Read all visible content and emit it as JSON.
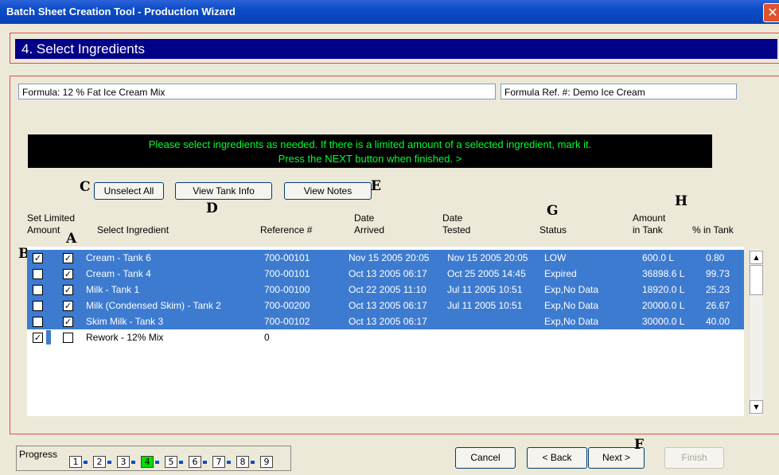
{
  "window": {
    "title": "Batch Sheet Creation Tool - Production Wizard",
    "close_glyph": "✕"
  },
  "step": {
    "title": "4. Select Ingredients"
  },
  "formula": {
    "name": "Formula: 12 % Fat Ice Cream Mix",
    "ref": "Formula Ref. #:  Demo Ice Cream"
  },
  "message": {
    "line1": "Please select ingredients as needed. If there is a limited amount of a selected ingredient, mark it.",
    "line2": "Press the NEXT button when finished. >"
  },
  "buttons": {
    "unselect_all": "Unselect All",
    "view_tank_info": "View Tank Info",
    "view_notes": "View Notes",
    "cancel": "Cancel",
    "back": "< Back",
    "next": "Next >",
    "finish": "Finish"
  },
  "annotations": {
    "A": "A",
    "B": "B",
    "C": "C",
    "D": "D",
    "E": "E",
    "F": "F",
    "G": "G",
    "H": "H"
  },
  "columns": {
    "set_limited_1": "Set Limited",
    "set_limited_2": "Amount",
    "select_ingredient": "Select Ingredient",
    "reference": "Reference #",
    "date_arrived_1": "Date",
    "date_arrived_2": "Arrived",
    "date_tested_1": "Date",
    "date_tested_2": "Tested",
    "status": "Status",
    "amount_1": "Amount",
    "amount_2": "in Tank",
    "pct": "% in Tank"
  },
  "rows": [
    {
      "limited": true,
      "selected": true,
      "name": "Cream - Tank 6",
      "ref": "700-00101",
      "arrived": "Nov 15 2005 20:05",
      "tested": "Nov 15 2005 20:05",
      "status": "LOW",
      "amount": "600.0 L",
      "pct": "0.80",
      "highlight": true
    },
    {
      "limited": false,
      "selected": true,
      "name": "Cream - Tank 4",
      "ref": "700-00101",
      "arrived": "Oct 13 2005 06:17",
      "tested": "Oct 25 2005 14:45",
      "status": "Expired",
      "amount": "36898.6 L",
      "pct": "99.73",
      "highlight": true
    },
    {
      "limited": false,
      "selected": true,
      "name": "Milk - Tank 1",
      "ref": "700-00100",
      "arrived": "Oct 22 2005 11:10",
      "tested": "Jul 11 2005 10:51",
      "status": "Exp,No Data",
      "amount": "18920.0 L",
      "pct": "25.23",
      "highlight": true
    },
    {
      "limited": false,
      "selected": true,
      "name": "Milk (Condensed Skim) - Tank 2",
      "ref": "700-00200",
      "arrived": "Oct 13 2005 06:17",
      "tested": "Jul 11 2005 10:51",
      "status": "Exp,No Data",
      "amount": "20000.0 L",
      "pct": "26.67",
      "highlight": true
    },
    {
      "limited": false,
      "selected": true,
      "name": "Skim Milk - Tank 3",
      "ref": "700-00102",
      "arrived": "Oct 13 2005 06:17",
      "tested": "",
      "status": "Exp,No Data",
      "amount": "30000.0 L",
      "pct": "40.00",
      "highlight": true
    },
    {
      "limited": true,
      "selected": false,
      "name": "Rework - 12% Mix",
      "ref": "0",
      "arrived": "",
      "tested": "",
      "status": "",
      "amount": "",
      "pct": "",
      "highlight": false
    }
  ],
  "scroll": {
    "up": "▲",
    "down": "▼"
  },
  "progress": {
    "label": "Progress",
    "steps": [
      "1",
      "2",
      "3",
      "4",
      "5",
      "6",
      "7",
      "8",
      "9"
    ],
    "current": 4
  },
  "check_glyph": "✓"
}
